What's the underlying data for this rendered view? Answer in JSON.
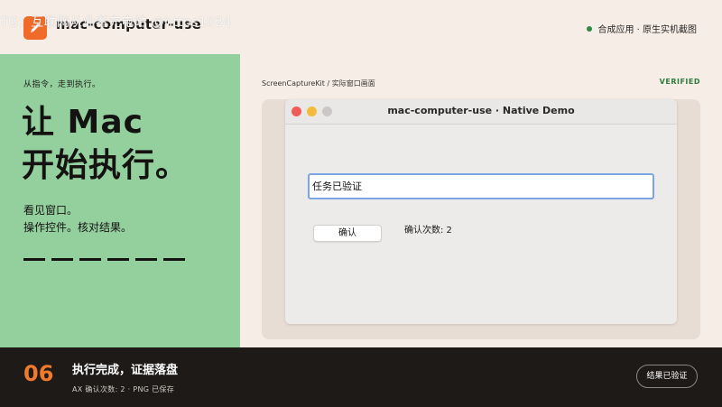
{
  "header": {
    "app_name": "mac-computer-use",
    "watermark": "TG：互联网从业者充电站 @https1024",
    "right_status": "合成应用 · 原生实机截图",
    "status_color": "#2f8a4a"
  },
  "left": {
    "eyebrow": "从指令，走到执行。",
    "headline_line1": "让 Mac",
    "headline_line2": "开始执行。",
    "sub_line1": "看见窗口。",
    "sub_line2": "操作控件。核对结果。",
    "accent_color": "#94cf9e"
  },
  "stage": {
    "caption": "ScreenCaptureKit / 实际窗口画面",
    "verified": "VERIFIED"
  },
  "window": {
    "title": "mac-computer-use · Native Demo",
    "input_value": "任务已验证",
    "confirm_label": "确认",
    "confirm_count": "确认次数: 2"
  },
  "footer": {
    "step_number": "06",
    "step_title": "执行完成，证据落盘",
    "step_sub": "AX 确认次数: 2 · PNG 已保存",
    "result_button": "结果已验证",
    "accent_color": "#f07a2c"
  }
}
